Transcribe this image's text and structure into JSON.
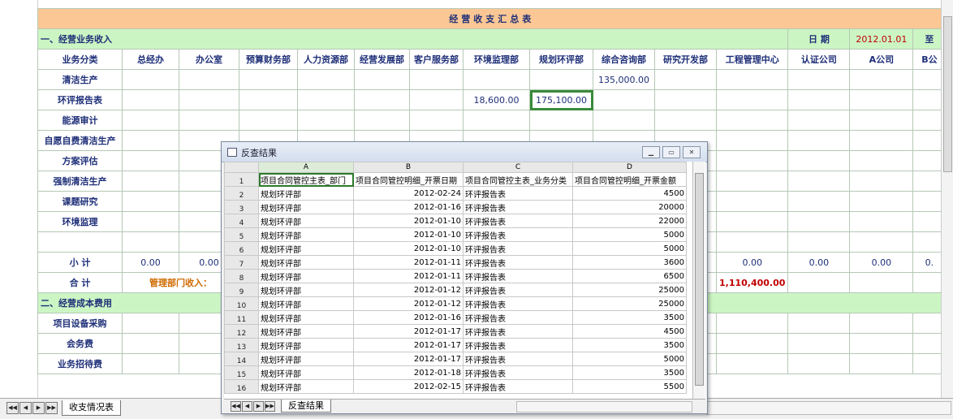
{
  "title": "经营收支汇总表",
  "section1": {
    "label": "一、经营业务收入",
    "date_label": "日  期",
    "date_value": "2012.01.01",
    "trailing_label": "至"
  },
  "columns": [
    "业务分类",
    "总经办",
    "办公室",
    "预算财务部",
    "人力资源部",
    "经营发展部",
    "客户服务部",
    "环境监理部",
    "规划环评部",
    "综合咨询部",
    "研究开发部",
    "工程管理中心",
    "认证公司",
    "A公司",
    "B公"
  ],
  "income_rows": [
    {
      "label": "清洁生产",
      "consult": "135,000.00"
    },
    {
      "label": "环评报告表",
      "env_supervision": "18,600.00",
      "planning": "175,100.00"
    },
    {
      "label": "能源审计"
    },
    {
      "label": "自愿自费清洁生产"
    },
    {
      "label": "方案评估"
    },
    {
      "label": "强制清洁生产"
    },
    {
      "label": "课题研究"
    },
    {
      "label": "环境监理"
    }
  ],
  "subtotal": {
    "label": "小  计",
    "zero": "0.00",
    "trailing_zero": "0."
  },
  "total": {
    "label": "合  计",
    "mgmt_label": "管理部门收入：",
    "value": "1,110,400.00"
  },
  "section2": {
    "label": "二、经营成本费用",
    "rows": [
      "项目设备采购",
      "会务费",
      "业务招待费"
    ]
  },
  "sheet_tab": "收支情况表",
  "dialog": {
    "title": "反查结果",
    "col_letters": [
      "A",
      "B",
      "C",
      "D"
    ],
    "headers": [
      "项目合同管控主表_部门",
      "项目合同管控明细_开票日期",
      "项目合同管控主表_业务分类",
      "项目合同管控明细_开票金额"
    ],
    "rows": [
      [
        "规划环评部",
        "2012-02-24",
        "环评报告表",
        "4500"
      ],
      [
        "规划环评部",
        "2012-01-16",
        "环评报告表",
        "20000"
      ],
      [
        "规划环评部",
        "2012-01-10",
        "环评报告表",
        "22000"
      ],
      [
        "规划环评部",
        "2012-01-10",
        "环评报告表",
        "5000"
      ],
      [
        "规划环评部",
        "2012-01-10",
        "环评报告表",
        "5000"
      ],
      [
        "规划环评部",
        "2012-01-11",
        "环评报告表",
        "3600"
      ],
      [
        "规划环评部",
        "2012-01-11",
        "环评报告表",
        "6500"
      ],
      [
        "规划环评部",
        "2012-01-12",
        "环评报告表",
        "25000"
      ],
      [
        "规划环评部",
        "2012-01-12",
        "环评报告表",
        "25000"
      ],
      [
        "规划环评部",
        "2012-01-16",
        "环评报告表",
        "3500"
      ],
      [
        "规划环评部",
        "2012-01-17",
        "环评报告表",
        "4500"
      ],
      [
        "规划环评部",
        "2012-01-17",
        "环评报告表",
        "3500"
      ],
      [
        "规划环评部",
        "2012-01-17",
        "环评报告表",
        "5000"
      ],
      [
        "规划环评部",
        "2012-01-18",
        "环评报告表",
        "3500"
      ],
      [
        "规划环评部",
        "2012-02-15",
        "环评报告表",
        "5500"
      ]
    ],
    "sheet_tab": "反查结果"
  },
  "icons": {
    "first": "◀◀",
    "prev": "◀",
    "next": "▶",
    "last": "▶▶",
    "minimize": "▁",
    "maximize": "▭",
    "close": "✕"
  },
  "colors": {
    "title_bg": "#fbc794",
    "section_bg": "#ccf5c4",
    "highlight": "#3a8a3a",
    "red": "#c00000",
    "orange": "#d06a00"
  }
}
